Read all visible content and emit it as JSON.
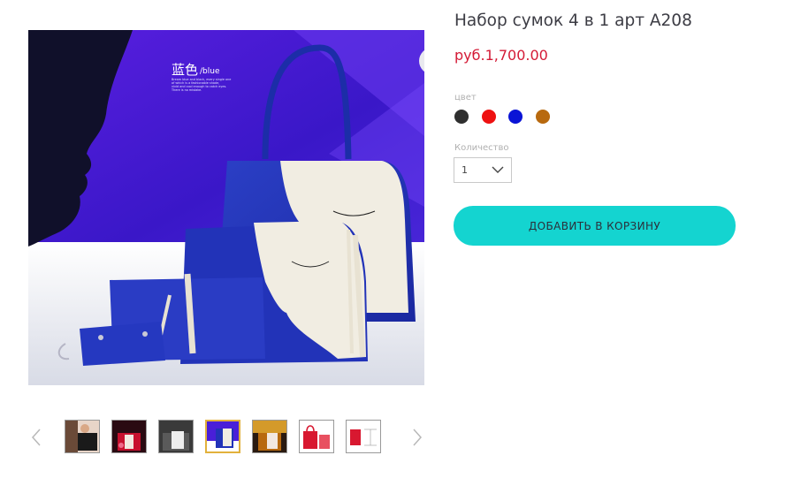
{
  "product": {
    "title": "Набор сумок 4 в 1 арт A208",
    "price": "руб.1,700.00"
  },
  "image_caption": {
    "chinese": "蓝色",
    "suffix": "/blue",
    "body_lines": [
      "Bream blue and black, every single one",
      "of which is a fashionable shade,",
      "vivid and cool enough to catch eyes.",
      "There is no mistake."
    ]
  },
  "color_option": {
    "label": "цвет",
    "swatches": [
      {
        "name": "black",
        "color": "#2f2f2f"
      },
      {
        "name": "red",
        "color": "#ee1111"
      },
      {
        "name": "blue",
        "color": "#0a14d6"
      },
      {
        "name": "brown",
        "color": "#b8690f"
      }
    ]
  },
  "quantity": {
    "label": "Количество",
    "value": "1"
  },
  "cart": {
    "button_label": "ДОБАВИТЬ В КОРЗИНУ"
  },
  "gallery": {
    "thumbnails": [
      {
        "name": "black-bag"
      },
      {
        "name": "red-bag"
      },
      {
        "name": "grey-bag"
      },
      {
        "name": "blue-bag",
        "active": true
      },
      {
        "name": "brown-bag"
      },
      {
        "name": "red-bag-sketch"
      },
      {
        "name": "red-bag-dimensions"
      }
    ]
  },
  "colors": {
    "accent": "#14d4d0",
    "price": "#d41a36",
    "active_thumb_border": "#e2b13c"
  }
}
